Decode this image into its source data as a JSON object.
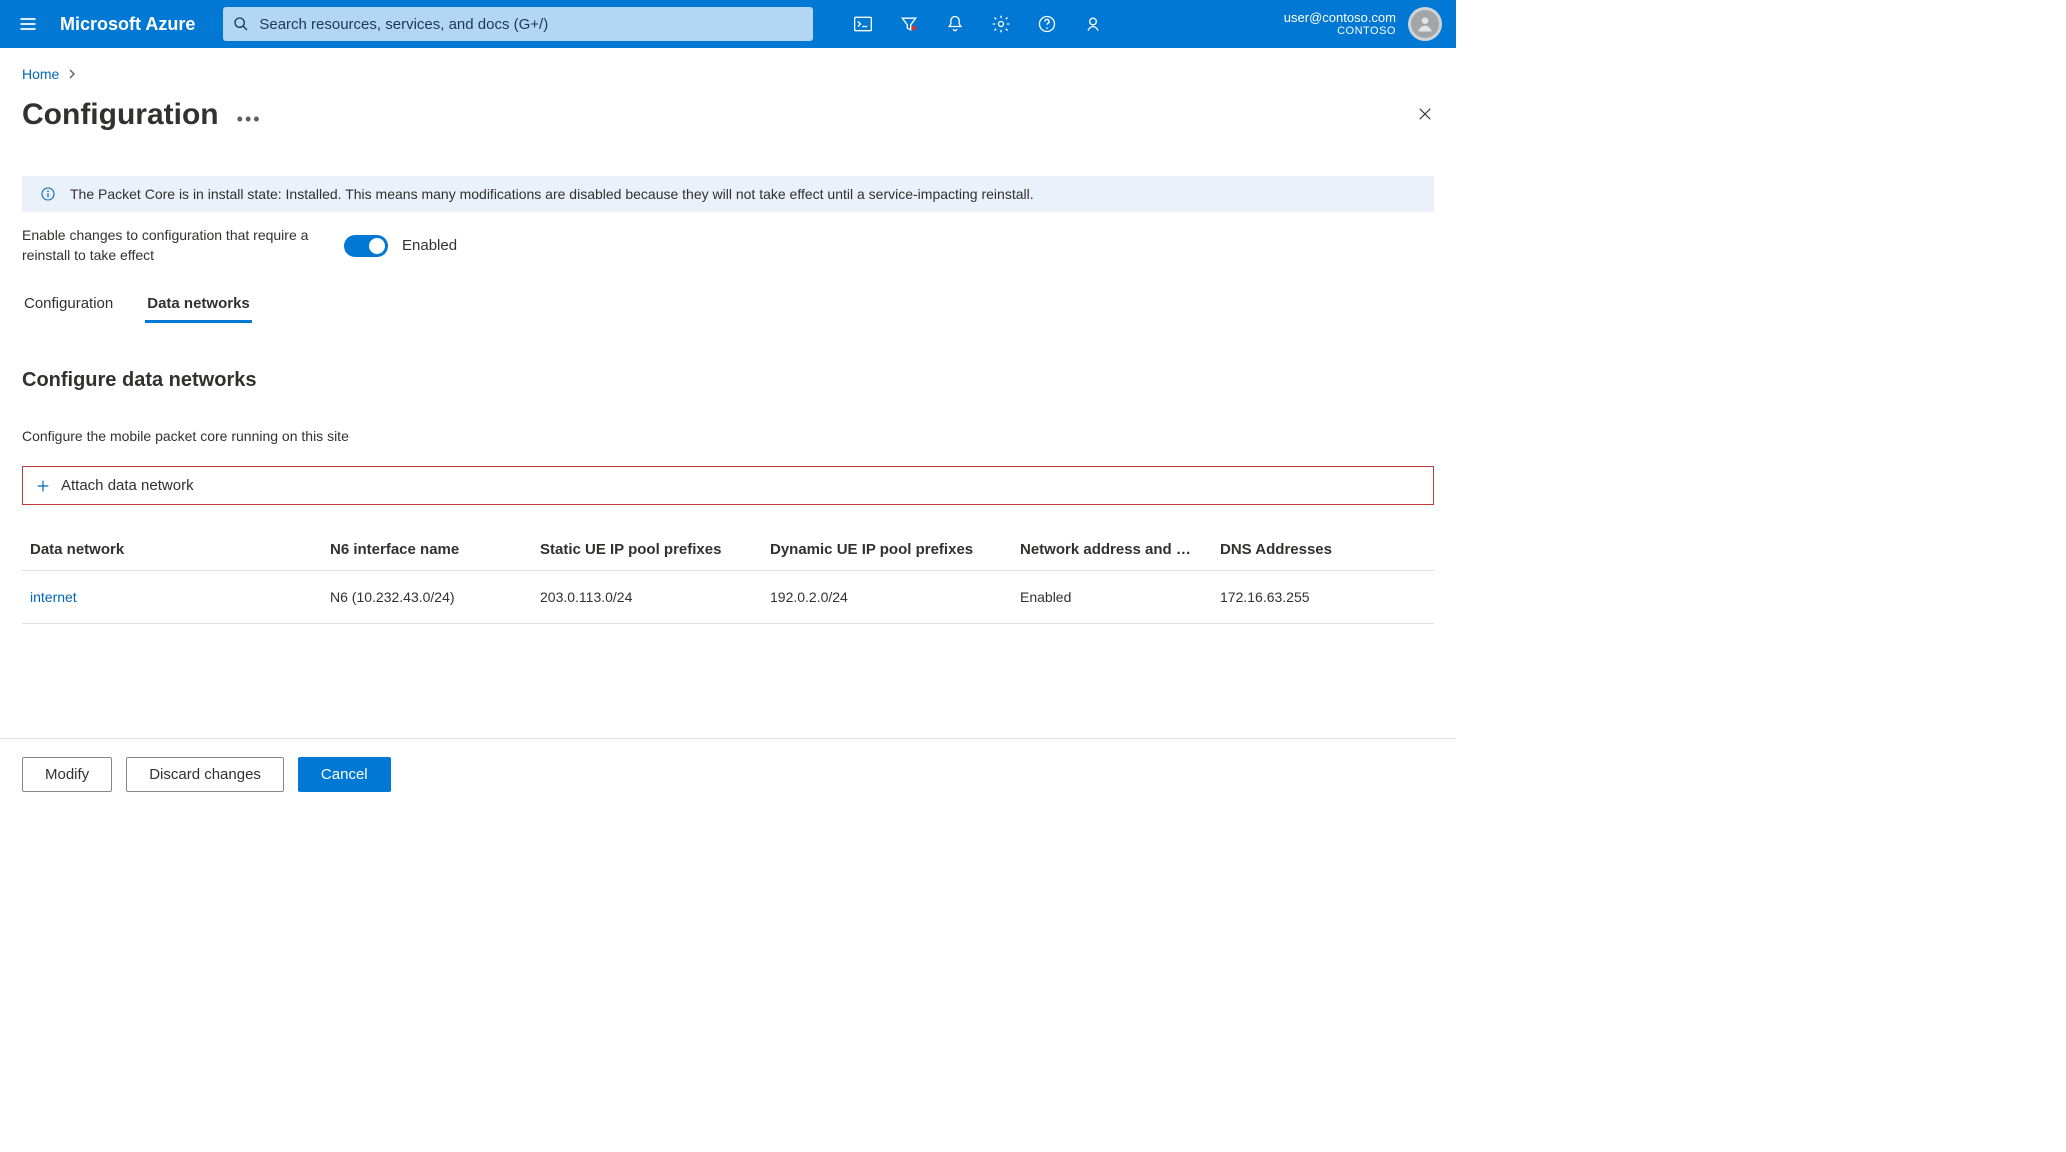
{
  "topbar": {
    "brand": "Microsoft Azure",
    "search_placeholder": "Search resources, services, and docs (G+/)"
  },
  "account": {
    "email": "user@contoso.com",
    "org": "CONTOSO"
  },
  "breadcrumb": {
    "item0": "Home"
  },
  "page": {
    "title": "Configuration"
  },
  "banner": {
    "text": "The Packet Core is in install state: Installed. This means many modifications are disabled because they will not take effect until a service-impacting reinstall."
  },
  "toggle": {
    "label": "Enable changes to configuration that require a reinstall to take effect",
    "state_text": "Enabled"
  },
  "tabs": {
    "t0": "Configuration",
    "t1": "Data networks"
  },
  "section": {
    "title": "Configure data networks",
    "desc": "Configure the mobile packet core running on this site",
    "attach_label": "Attach data network"
  },
  "table": {
    "headers": {
      "c0": "Data network",
      "c1": "N6 interface name",
      "c2": "Static UE IP pool prefixes",
      "c3": "Dynamic UE IP pool prefixes",
      "c4": "Network address and …",
      "c5": "DNS Addresses"
    },
    "rows": [
      {
        "c0": "internet",
        "c1": "N6 (10.232.43.0/24)",
        "c2": "203.0.113.0/24",
        "c3": "192.0.2.0/24",
        "c4": "Enabled",
        "c5": "172.16.63.255"
      }
    ]
  },
  "footer": {
    "modify": "Modify",
    "discard": "Discard changes",
    "cancel": "Cancel"
  }
}
